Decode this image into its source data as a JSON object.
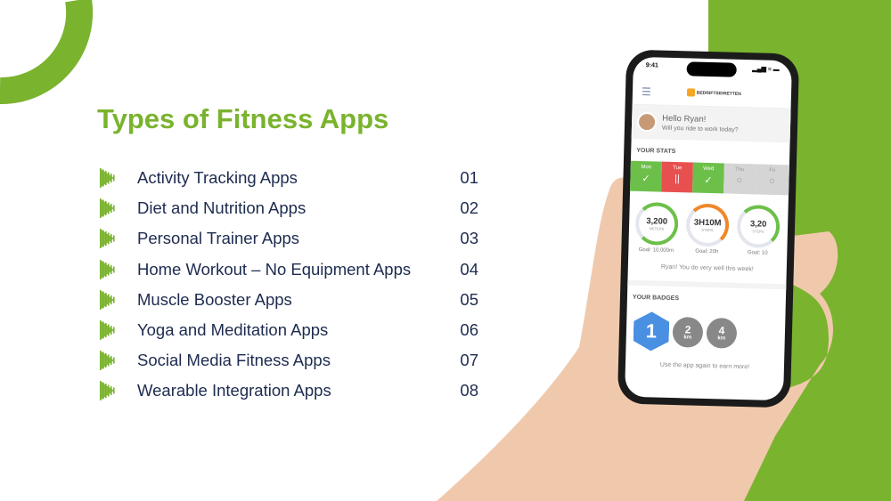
{
  "colors": {
    "accent": "#7ab32e",
    "text": "#1d2b4f"
  },
  "title": "Types of Fitness Apps",
  "items": [
    {
      "label": "Activity Tracking Apps",
      "num": "01"
    },
    {
      "label": "Diet and Nutrition Apps",
      "num": "02"
    },
    {
      "label": "Personal Trainer Apps",
      "num": "03"
    },
    {
      "label": " Home Workout – No Equipment Apps",
      "num": "04"
    },
    {
      "label": "Muscle Booster Apps",
      "num": "05"
    },
    {
      "label": "Yoga and Meditation Apps",
      "num": "06"
    },
    {
      "label": "Social Media Fitness Apps",
      "num": "07"
    },
    {
      "label": "Wearable Integration Apps",
      "num": "08"
    }
  ],
  "phone": {
    "time": "9:41",
    "logo": "BEDRIFTSIDRETTEN",
    "greeting": "Hello Ryan!",
    "question": "Will you ride to work today?",
    "stats_title": "YOUR STATS",
    "days": [
      {
        "d": "Mon",
        "s": "done"
      },
      {
        "d": "Tue",
        "s": "missed"
      },
      {
        "d": "Wed",
        "s": "done"
      },
      {
        "d": "Thu",
        "s": "pending"
      },
      {
        "d": "Fri",
        "s": "pending"
      }
    ],
    "stats": [
      {
        "v": "3,200",
        "u": "METERS",
        "goal": "Goal: 10,000m",
        "color": "#6cc04a"
      },
      {
        "v": "3H10M",
        "u": "STEPS",
        "goal": "Goal: 20h",
        "color": "#f0872a"
      },
      {
        "v": "3,20",
        "u": "STEPS",
        "goal": "Goal: 10",
        "color": "#6cc04a"
      }
    ],
    "message": "Ryan! You do very well this week!",
    "badges_title": "YOUR BADGES",
    "badges": [
      {
        "n": "1"
      },
      {
        "n": "2",
        "u": "km"
      },
      {
        "n": "4",
        "u": "km"
      }
    ],
    "earn": "Use the app again to earn more!"
  }
}
